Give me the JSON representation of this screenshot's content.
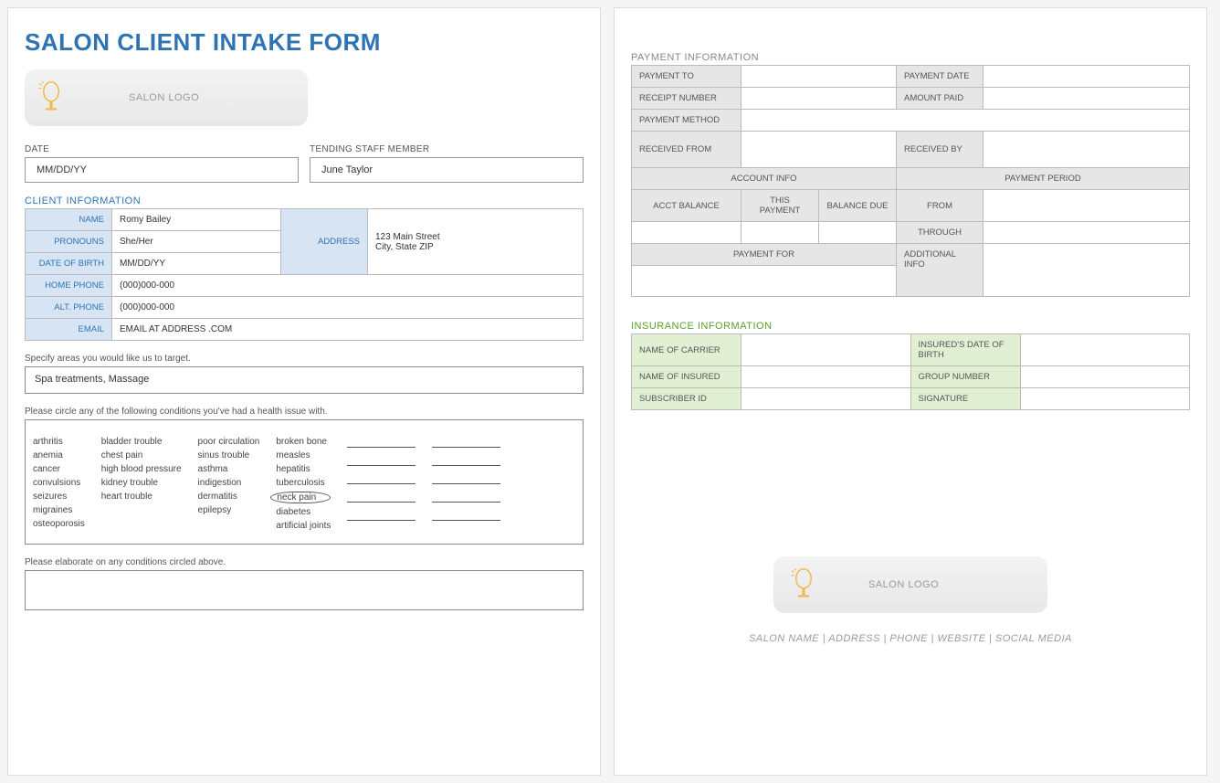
{
  "title": "SALON CLIENT INTAKE FORM",
  "logo_text": "SALON LOGO",
  "date_label": "DATE",
  "date_value": "MM/DD/YY",
  "staff_label": "TENDING STAFF MEMBER",
  "staff_value": "June Taylor",
  "client_header": "CLIENT INFORMATION",
  "client": {
    "name_l": "NAME",
    "name_v": "Romy Bailey",
    "pronouns_l": "PRONOUNS",
    "pronouns_v": "She/Her",
    "dob_l": "DATE OF BIRTH",
    "dob_v": "MM/DD/YY",
    "address_l": "ADDRESS",
    "address_v": "123 Main Street\nCity, State ZIP",
    "home_l": "HOME PHONE",
    "home_v": "(000)000-000",
    "alt_l": "ALT. PHONE",
    "alt_v": "(000)000-000",
    "email_l": "EMAIL",
    "email_v": "EMAIL AT ADDRESS .COM"
  },
  "target_label": "Specify areas you would like us to target.",
  "target_value": "Spa treatments, Massage",
  "cond_label": "Please circle any of the following conditions you've had a health issue with.",
  "cond_cols": [
    [
      "arthritis",
      "anemia",
      "cancer",
      "convulsions",
      "seizures",
      "migraines",
      "osteoporosis"
    ],
    [
      "bladder trouble",
      "chest pain",
      "high blood pressure",
      "kidney trouble",
      "heart trouble"
    ],
    [
      "poor circulation",
      "sinus trouble",
      "asthma",
      "indigestion",
      "dermatitis",
      "epilepsy"
    ],
    [
      "broken bone",
      "measles",
      "hepatitis",
      "tuberculosis",
      "neck pain",
      "diabetes",
      "artificial joints"
    ]
  ],
  "circled_item": "neck pain",
  "elaborate_label": "Please elaborate on any conditions circled above.",
  "payment_header": "PAYMENT INFORMATION",
  "pay": {
    "to": "PAYMENT TO",
    "date": "PAYMENT DATE",
    "receipt": "RECEIPT NUMBER",
    "amount": "AMOUNT PAID",
    "method": "PAYMENT METHOD",
    "recfrom": "RECEIVED FROM",
    "recby": "RECEIVED BY",
    "acctinfo": "ACCOUNT INFO",
    "period": "PAYMENT PERIOD",
    "acctbal": "ACCT BALANCE",
    "thispay": "THIS PAYMENT",
    "baldue": "BALANCE DUE",
    "from": "FROM",
    "through": "THROUGH",
    "payfor": "PAYMENT FOR",
    "addinfo": "ADDITIONAL INFO"
  },
  "ins_header": "INSURANCE INFORMATION",
  "ins": {
    "carrier": "NAME OF CARRIER",
    "idob": "INSURED'S DATE OF BIRTH",
    "insured": "NAME OF INSURED",
    "group": "GROUP NUMBER",
    "subid": "SUBSCRIBER ID",
    "sig": "SIGNATURE"
  },
  "footer": "SALON NAME   |   ADDRESS   |   PHONE   |   WEBSITE   |   SOCIAL MEDIA"
}
